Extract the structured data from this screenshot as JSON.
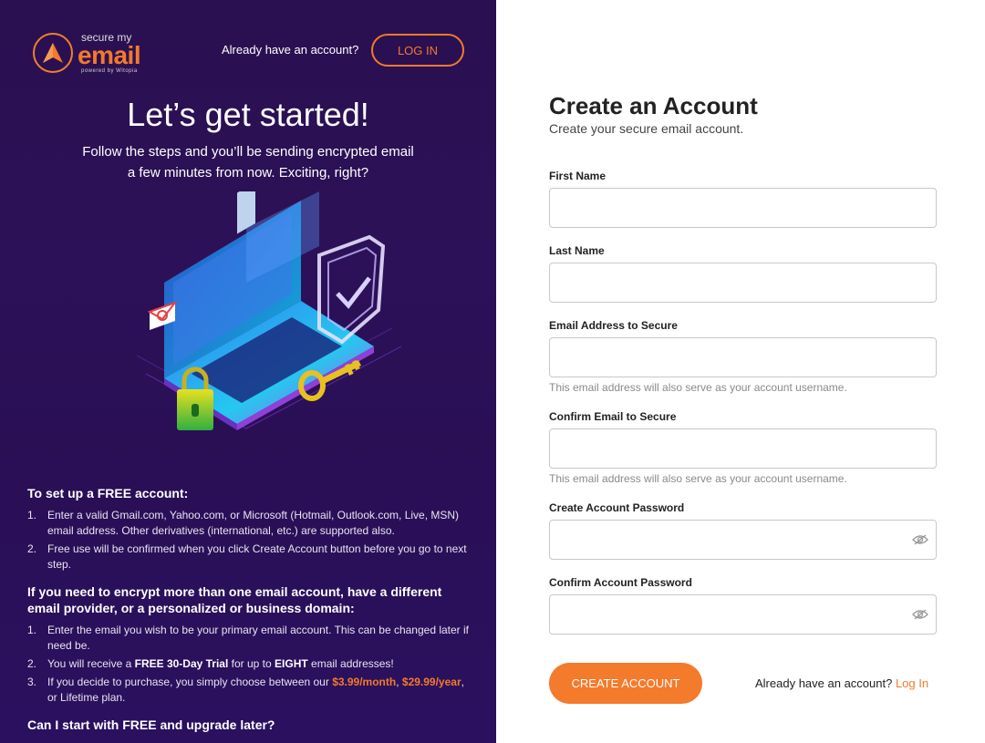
{
  "brand": {
    "small": "secure my",
    "big": "email",
    "powered": "powered by Witopia",
    "accent": "#f27a2a"
  },
  "header": {
    "have_account": "Already have an account?",
    "login_label": "LOG IN"
  },
  "hero": {
    "headline": "Let’s get started!",
    "sub_line1": "Follow the steps and you’ll be sending encrypted email",
    "sub_line2": "a few minutes from now. Exciting, right?"
  },
  "info": {
    "free_heading": "To set up a FREE account:",
    "free_items": [
      {
        "num": "1.",
        "text": "Enter a valid Gmail.com, Yahoo.com, or Microsoft (Hotmail, Outlook.com, Live, MSN) email address. Other derivatives (international, etc.) are supported also."
      },
      {
        "num": "2.",
        "text": "Free use will be confirmed when you click Create Account button before you go to next step."
      }
    ],
    "multi_heading": "If you need to encrypt more than one email account, have a different email provider, or a personalized or business domain:",
    "multi_items": [
      {
        "num": "1.",
        "text": "Enter the email you wish to be your primary email account. This can be changed later if need be."
      },
      {
        "num": "2.",
        "pre": "You will receive a ",
        "b1": "FREE 30-Day Trial",
        "mid": " for up to ",
        "b2": "EIGHT",
        "post": " email addresses!"
      },
      {
        "num": "3.",
        "pre": "If you decide to purchase, you simply choose between our ",
        "p1": "$3.99/month",
        "mid": ", ",
        "p2": "$29.99/year",
        "post": ", or Lifetime plan."
      }
    ],
    "upgrade_heading": "Can I start with FREE and upgrade later?"
  },
  "form": {
    "title": "Create an Account",
    "subtitle": "Create your secure email account.",
    "first_name_label": "First Name",
    "first_name_value": "",
    "last_name_label": "Last Name",
    "last_name_value": "",
    "email_label": "Email Address to Secure",
    "email_value": "",
    "email_hint": "This email address will also serve as your account username.",
    "confirm_email_label": "Confirm Email to Secure",
    "confirm_email_value": "",
    "confirm_email_hint": "This email address will also serve as your account username.",
    "password_label": "Create Account Password",
    "password_value": "",
    "confirm_password_label": "Confirm Account Password",
    "confirm_password_value": "",
    "submit_label": "CREATE ACCOUNT",
    "bottom_have_account": "Already have an account?",
    "bottom_login_link": "Log In"
  }
}
